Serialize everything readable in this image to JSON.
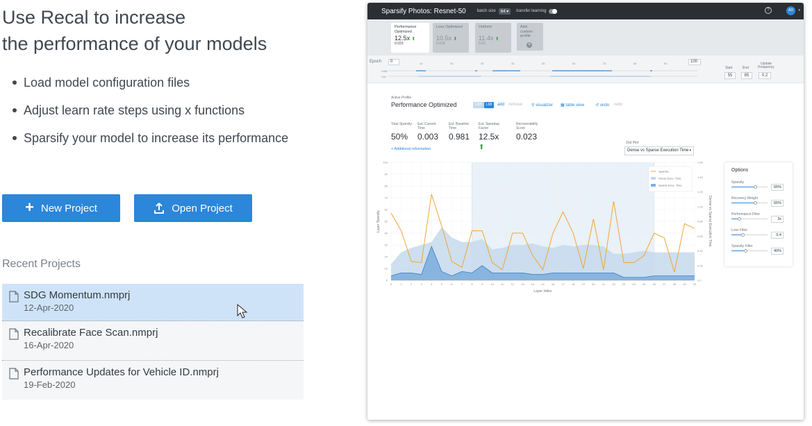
{
  "hero": {
    "title_line1": "Use Recal to increase",
    "title_line2": "the performance of your models"
  },
  "bullets": [
    "Load model configuration files",
    "Adjust learn rate steps using x functions",
    "Sparsify your model to increase its performance"
  ],
  "actions": {
    "new_project": "New Project",
    "open_project": "Open Project"
  },
  "recent": {
    "title": "Recent Projects",
    "projects": [
      {
        "name": "SDG Momentum.nmprj",
        "date": "12-Apr-2020",
        "selected": true
      },
      {
        "name": "Recalibrate Face Scan.nmprj",
        "date": "16-Apr-2020",
        "selected": false
      },
      {
        "name": "Performance Updates for Vehicle ID.nmprj",
        "date": "19-Feb-2020",
        "selected": false
      }
    ]
  },
  "app": {
    "title": "Sparsify Photos: Resnet-50",
    "batch_size_label": "batch size",
    "batch_size_value": "64 ▾",
    "transfer_learning_label": "transfer learning",
    "avatar": "AD",
    "help_icon": "?",
    "profiles": [
      {
        "name": "Performance Optimized",
        "value": "12.5x",
        "sub": "0.023",
        "active": true
      },
      {
        "name": "Loss Optimized",
        "value": "10.5x",
        "sub": "0.018",
        "active": false
      },
      {
        "name": "Uniform",
        "value": "11.4x",
        "sub": "0.02",
        "active": false
      },
      {
        "name": "Add custom profile",
        "value": "",
        "sub": "",
        "active": false
      }
    ],
    "epoch": {
      "label": "Epoch",
      "start_value": "0",
      "end_value": "100",
      "ticks": [
        "10",
        "20",
        "30",
        "40",
        "50",
        "60",
        "70",
        "80",
        "90"
      ],
      "lr_label": "LRM",
      "lm_label": "LMI",
      "start_label": "Start",
      "end_label": "End",
      "update_label": "Update Frequency",
      "start": "55",
      "end": "85",
      "update": "0.2"
    },
    "active_profile_label": "Active Profile",
    "active_profile": "Performance Optimized",
    "chips": [
      "LRB",
      "LMI"
    ],
    "toolbar": {
      "add": "add",
      "remove": "remove",
      "visualizer": "visualizer",
      "table_view": "table view",
      "undo": "undo",
      "redo": "redo"
    },
    "metrics": [
      {
        "label": "Total Sparsity",
        "value": "50%",
        "up": false
      },
      {
        "label": "Est. Current Time",
        "value": "0.003",
        "up": false
      },
      {
        "label": "Est. Baseline Time",
        "value": "0.981",
        "up": false
      },
      {
        "label": "Est. Speedup Factor",
        "value": "12.5x",
        "up": true
      },
      {
        "label": "Recoverability Score",
        "value": "0.023",
        "up": false
      }
    ],
    "additional_info": "+ Additional information",
    "plot2_label": "2nd Plot",
    "plot2_value": "Dense vs Sparse Execution Time",
    "options": {
      "title": "Options",
      "rows": [
        {
          "label": "Sparsity",
          "value": "65%",
          "level": 0.65
        },
        {
          "label": "Recovery Weight",
          "value": "65%",
          "level": 0.65
        },
        {
          "label": "Performance Filter",
          "value": "3x",
          "level": 0.2
        },
        {
          "label": "Loss Filter",
          "value": "0.4",
          "level": 0.3
        },
        {
          "label": "Sparsity Filter",
          "value": "40%",
          "level": 0.38
        }
      ]
    }
  },
  "colors": {
    "primary": "#2c86d9",
    "sparsity_line": "#f2a531",
    "dense_area": "#c6d9ec",
    "sparse_area": "#7fb0dd",
    "sparse_line": "#3b7dc4"
  },
  "chart_data": {
    "type": "line",
    "xlabel": "Layer Index",
    "ylabel": "Layer Sparsity",
    "y2label": "Dense vs Sparse Execution Time",
    "x": [
      0,
      1,
      2,
      3,
      4,
      5,
      6,
      7,
      8,
      9,
      10,
      11,
      12,
      13,
      14,
      15,
      16,
      17,
      18,
      19,
      20,
      21,
      22,
      23,
      24,
      25,
      26,
      27,
      28,
      29,
      30
    ],
    "ylim": [
      0,
      100
    ],
    "y2lim": [
      0,
      1.6
    ],
    "y_ticks": [
      "0",
      "10",
      "20",
      "30",
      "40",
      "50",
      "60",
      "70",
      "80",
      "90",
      "100"
    ],
    "y2_ticks": [
      "0.0",
      "0.20",
      "0.40",
      "0.60",
      "0.80",
      "1.00",
      "1.20",
      "1.40",
      "1.60"
    ],
    "legend_position": "top-right",
    "highlight_range": [
      8,
      26
    ],
    "series": [
      {
        "name": "Sparsity",
        "values": [
          57,
          42,
          16,
          15,
          73,
          46,
          16,
          11,
          42,
          42,
          15,
          9,
          40,
          40,
          21,
          9,
          40,
          58,
          40,
          10,
          52,
          9,
          67,
          15,
          15,
          21,
          40,
          36,
          7,
          48,
          44
        ]
      },
      {
        "name": "Dense Exec. Time",
        "values": [
          0.22,
          0.38,
          0.44,
          0.48,
          0.52,
          0.72,
          0.58,
          0.52,
          0.52,
          0.56,
          0.42,
          0.44,
          0.48,
          0.48,
          0.5,
          0.46,
          0.44,
          0.48,
          0.46,
          0.48,
          0.48,
          0.46,
          0.36,
          0.36,
          0.38,
          0.4,
          0.38,
          0.38,
          0.38,
          0.38,
          0.38
        ]
      },
      {
        "name": "Sparse Exec. Time",
        "values": [
          0.06,
          0.1,
          0.1,
          0.08,
          0.46,
          0.12,
          0.06,
          0.12,
          0.1,
          0.2,
          0.1,
          0.1,
          0.1,
          0.1,
          0.08,
          0.08,
          0.1,
          0.1,
          0.1,
          0.1,
          0.1,
          0.1,
          0.1,
          0.04,
          0.04,
          0.04,
          0.06,
          0.06,
          0.06,
          0.06,
          0.06
        ]
      }
    ]
  }
}
